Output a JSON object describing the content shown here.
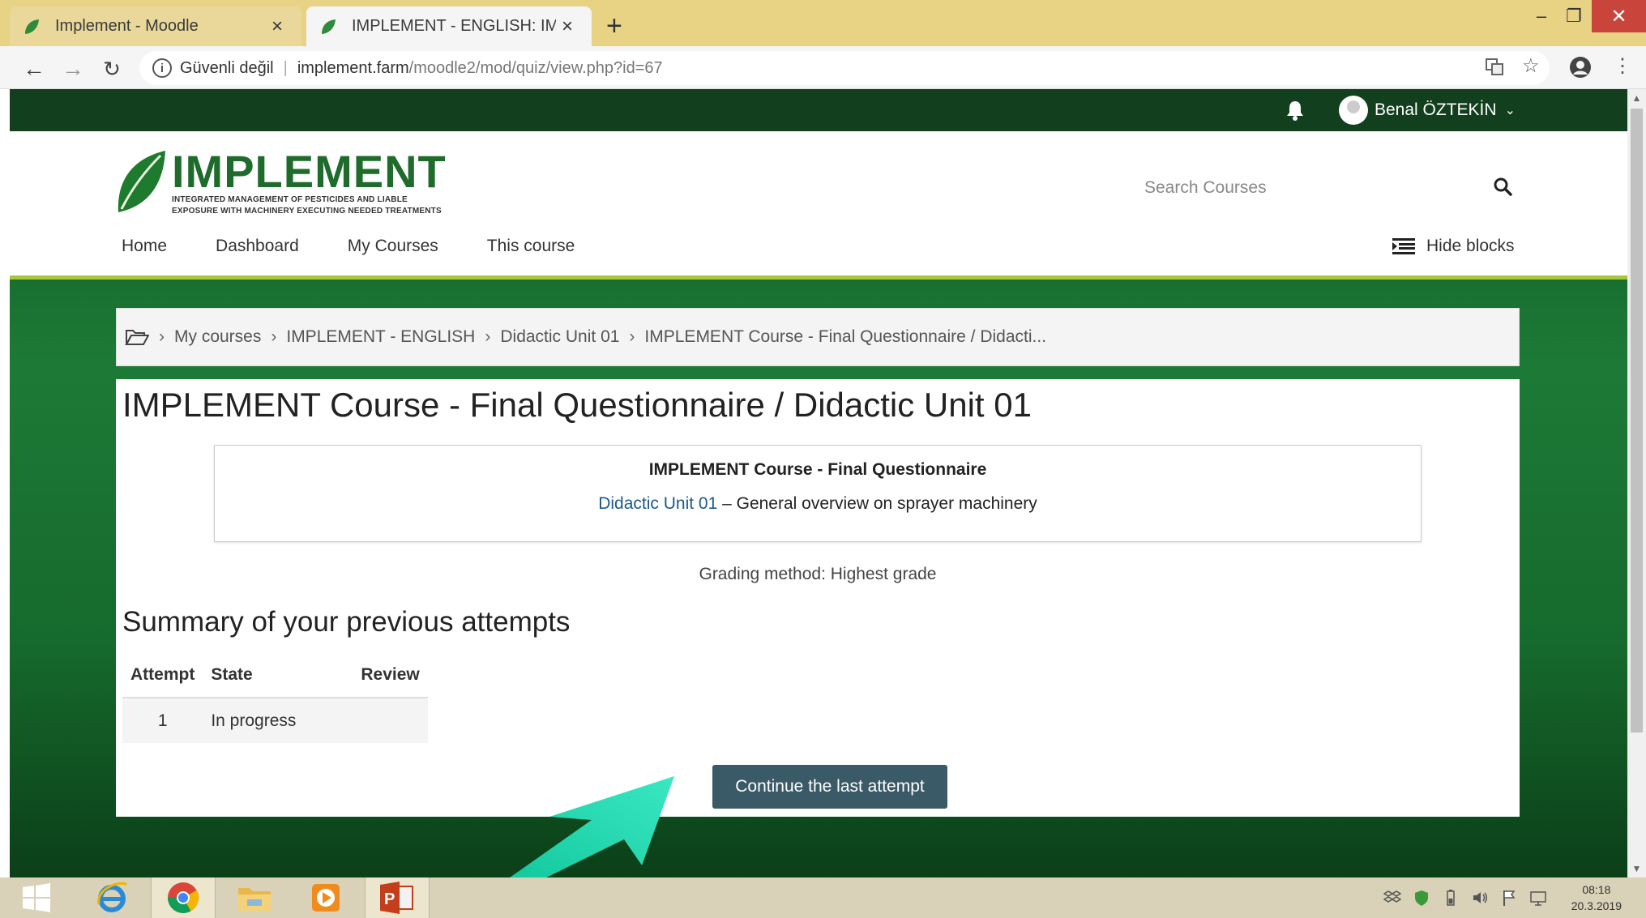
{
  "browser": {
    "tabs": [
      {
        "title": "Implement - Moodle",
        "active": false
      },
      {
        "title": "IMPLEMENT - ENGLISH: IMPLEM",
        "active": true
      }
    ],
    "new_tab": "+",
    "address": {
      "security_label": "Güvenli değil",
      "domain": "implement.farm",
      "path": "/moodle2/mod/quiz/view.php?id=67"
    }
  },
  "topnav": {
    "user_name": "Benal ÖZTEKİN"
  },
  "header": {
    "logo_word": "IMPLEMENT",
    "logo_sub_1": "INTEGRATED MANAGEMENT OF PESTICIDES AND LIABLE",
    "logo_sub_2": "EXPOSURE WITH MACHINERY EXECUTING NEEDED TREATMENTS",
    "search_placeholder": "Search Courses",
    "nav": [
      "Home",
      "Dashboard",
      "My Courses",
      "This course"
    ],
    "hide_blocks": "Hide blocks"
  },
  "breadcrumb": [
    "My courses",
    "IMPLEMENT - ENGLISH",
    "Didactic Unit 01",
    "IMPLEMENT Course - Final Questionnaire / Didacti..."
  ],
  "main": {
    "title": "IMPLEMENT Course - Final Questionnaire / Didactic Unit 01",
    "quiz_name": "IMPLEMENT Course - Final Questionnaire",
    "unit_link": "Didactic Unit 01",
    "unit_rest": " – General overview on sprayer machinery",
    "grading": "Grading method: Highest grade",
    "summary_heading": "Summary of your previous attempts",
    "attempts_columns": [
      "Attempt",
      "State",
      "Review"
    ],
    "attempts_rows": [
      {
        "attempt": "1",
        "state": "In progress",
        "review": ""
      }
    ],
    "continue_button": "Continue the last attempt"
  },
  "taskbar": {
    "time": "08:18",
    "date": "20.3.2019"
  },
  "colors": {
    "brand_green": "#1e6b2c",
    "topbar": "#123f1e",
    "accent_line": "#a7c63c",
    "button": "#3a5a68",
    "arrow": "#1fd4b0"
  }
}
